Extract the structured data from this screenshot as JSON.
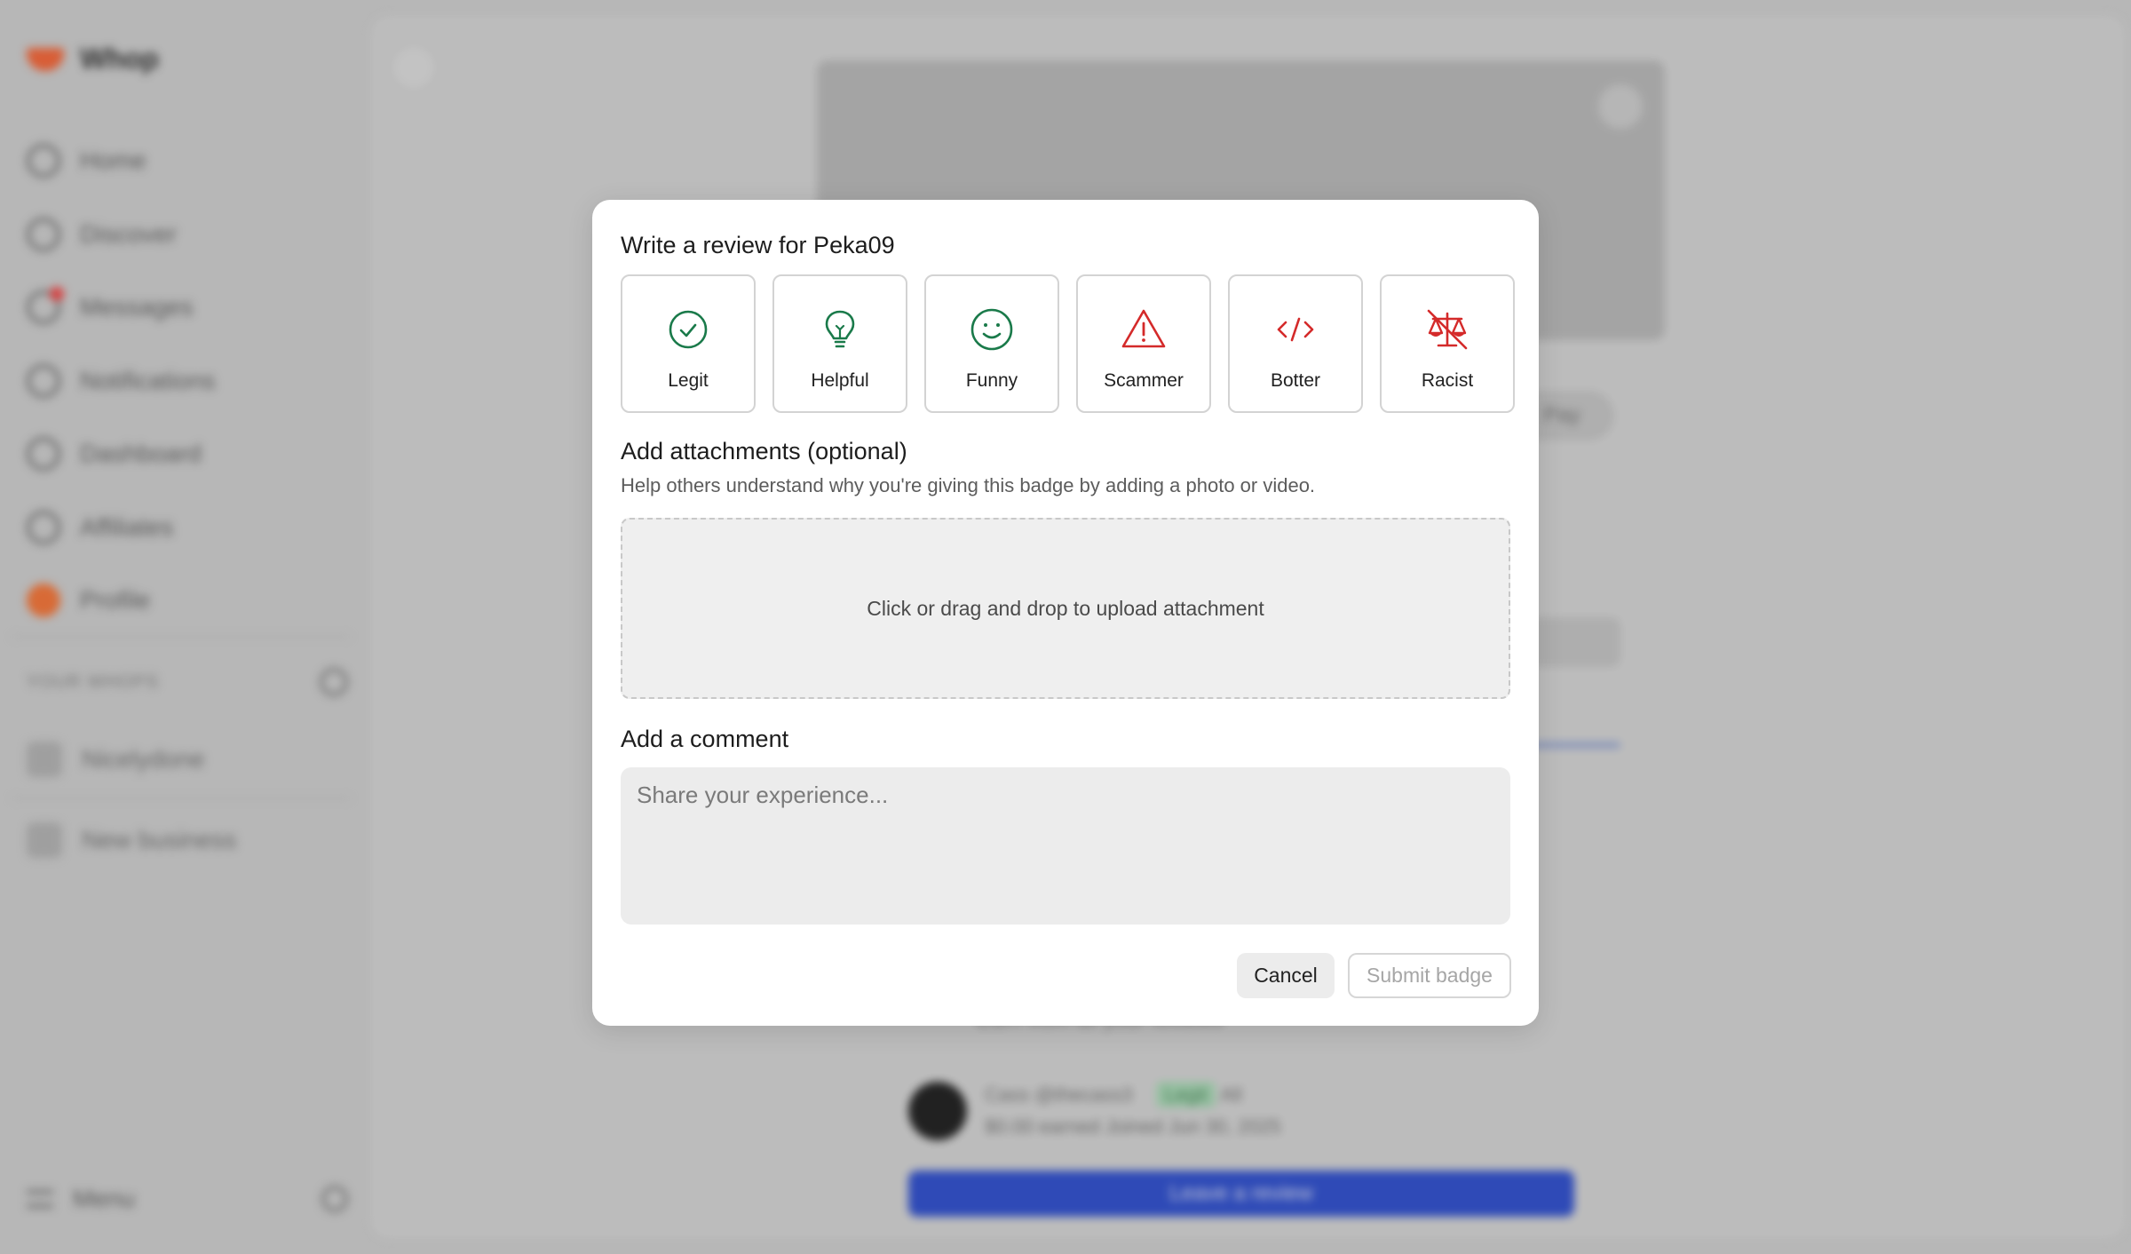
{
  "app": {
    "brand": "Whop",
    "nav": [
      {
        "label": "Home",
        "icon": "home-icon"
      },
      {
        "label": "Discover",
        "icon": "compass-icon"
      },
      {
        "label": "Messages",
        "icon": "message-icon"
      },
      {
        "label": "Notifications",
        "icon": "bell-icon"
      },
      {
        "label": "Dashboard",
        "icon": "dashboard-icon"
      },
      {
        "label": "Affiliates",
        "icon": "tag-icon"
      },
      {
        "label": "Profile",
        "icon": "avatar-icon"
      }
    ],
    "whops_heading": "YOUR WHOPS",
    "whops": [
      {
        "label": "Nicelydone",
        "icon": "whop-logo-icon"
      },
      {
        "label": "New business",
        "icon": "plus-icon"
      }
    ],
    "menu_label": "Menu",
    "pay_label": "Pay",
    "bg_text": "Earn from all your reviews",
    "reviewer": {
      "name": "Cass",
      "handle": "@thecass3",
      "badge": "Legit",
      "extra": "All",
      "earned": "$0.00 earned",
      "joined": "Joined Jun 30, 2025"
    },
    "leave_review": "Leave a review"
  },
  "modal": {
    "title": "Write a review for Peka09",
    "badges": [
      {
        "label": "Legit",
        "icon": "check-circle-icon",
        "color": "#1a7a4a"
      },
      {
        "label": "Helpful",
        "icon": "lightbulb-icon",
        "color": "#1a7a4a"
      },
      {
        "label": "Funny",
        "icon": "smile-icon",
        "color": "#1a7a4a"
      },
      {
        "label": "Scammer",
        "icon": "warning-icon",
        "color": "#d42a2a"
      },
      {
        "label": "Botter",
        "icon": "code-icon",
        "color": "#d42a2a"
      },
      {
        "label": "Racist",
        "icon": "scale-slash-icon",
        "color": "#d42a2a"
      }
    ],
    "attachments_title": "Add attachments (optional)",
    "attachments_desc": "Help others understand why you're giving this badge by adding a photo or video.",
    "dropzone_text": "Click or drag and drop to upload attachment",
    "comment_title": "Add a comment",
    "comment_placeholder": "Share your experience...",
    "comment_value": "",
    "cancel_label": "Cancel",
    "submit_label": "Submit badge"
  }
}
